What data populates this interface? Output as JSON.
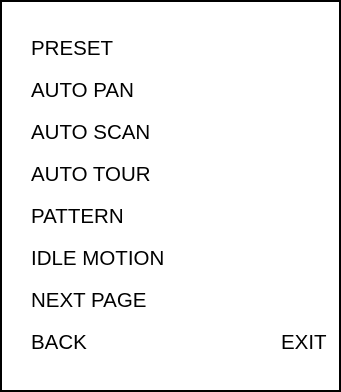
{
  "menu": {
    "items": [
      {
        "label": "PRESET"
      },
      {
        "label": "AUTO PAN"
      },
      {
        "label": "AUTO SCAN"
      },
      {
        "label": "AUTO TOUR"
      },
      {
        "label": "PATTERN"
      },
      {
        "label": "IDLE MOTION"
      },
      {
        "label": "NEXT PAGE"
      }
    ],
    "back_label": "BACK",
    "exit_label": "EXIT"
  }
}
